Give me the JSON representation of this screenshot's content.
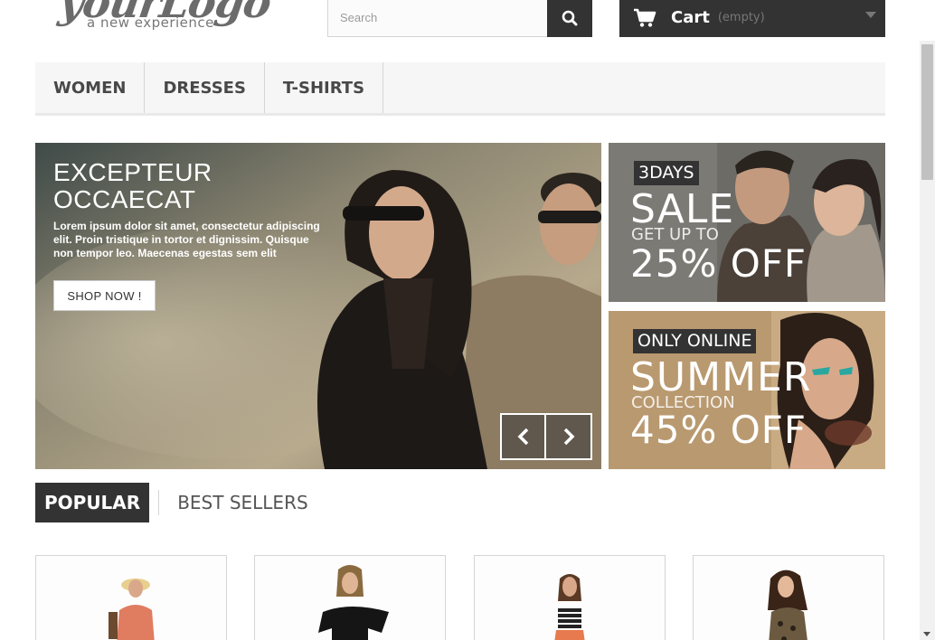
{
  "header": {
    "logo_script": "yourLogo",
    "logo_tagline": "a new experience",
    "search": {
      "placeholder": "Search"
    },
    "cart": {
      "label": "Cart",
      "status": "(empty)"
    }
  },
  "menu": {
    "items": [
      {
        "label": "WOMEN"
      },
      {
        "label": "DRESSES"
      },
      {
        "label": "T-SHIRTS"
      }
    ]
  },
  "slider": {
    "title": "EXCEPTEUR OCCAECAT",
    "text": "Lorem ipsum dolor sit amet, consectetur adipiscing elit. Proin tristique in tortor et dignissim. Quisque non tempor leo. Maecenas egestas sem elit",
    "button": "SHOP NOW !"
  },
  "banners": [
    {
      "tag": "3DAYS",
      "headline": "SALE",
      "subline": "GET UP TO",
      "discount": "25% OFF"
    },
    {
      "tag": "ONLY ONLINE",
      "headline": "SUMMER",
      "subline": "COLLECTION",
      "discount": "45% OFF"
    }
  ],
  "tabs": [
    {
      "label": "POPULAR",
      "active": true
    },
    {
      "label": "BEST SELLERS",
      "active": false
    }
  ],
  "colors": {
    "dark": "#333333",
    "menu_bg": "#f6f6f6",
    "border": "#d6d4d4"
  }
}
